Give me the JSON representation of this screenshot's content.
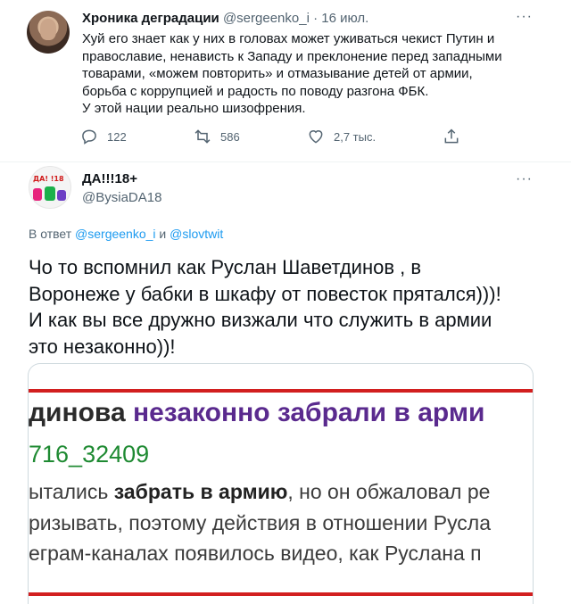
{
  "tweet": {
    "author_name": "Хроника деградации",
    "author_handle": "@sergeenko_i",
    "separator": " · ",
    "date": "16 июл.",
    "more": "···",
    "text_lines": [
      "Хуй его знает как у них в головах может уживаться чекист Путин и",
      "православие, ненависть к Западу и преклонение перед западными",
      "товарами, «можем повторить» и отмазывание детей от армии,",
      "борьба с коррупцией и радость по поводу разгона ФБК.",
      "У этой нации реально шизофрения."
    ],
    "replies": "122",
    "retweets": "586",
    "likes": "2,7 тыс."
  },
  "reply_tweet": {
    "author_name": "ДА!!!18+",
    "author_handle": "@BysiaDA18",
    "more": "···",
    "avatar_label": "ДА! !18",
    "reply_prefix": "В ответ ",
    "reply_user1": "@sergeenko_i",
    "reply_and": " и ",
    "reply_user2": "@slovtwit",
    "text_lines": [
      "Чо то  вспомнил как Руслан Шаветдинов , в",
      "Воронеже у бабки в шкафу от  повесток прятался)))!",
      "И как вы все дружно визжали что служить в армии",
      "это незаконно))!"
    ]
  },
  "media": {
    "line1_a": "динова ",
    "line1_b": "незаконно забрали в арми",
    "line2": "716_32409",
    "line3_a": "ытались ",
    "line3_b": "забрать в армию",
    "line3_c": ", но он обжаловал ре",
    "line4": "ризывать, поэтому действия в отношении Русла",
    "line5": "еграм-каналах появилось видео, как Руслана п"
  },
  "colors": {
    "link": "#1d9bf0",
    "secondary": "#536471",
    "media_red": "#d21f1f",
    "media_purple": "#5a2a8e",
    "media_green": "#1e8a32"
  }
}
